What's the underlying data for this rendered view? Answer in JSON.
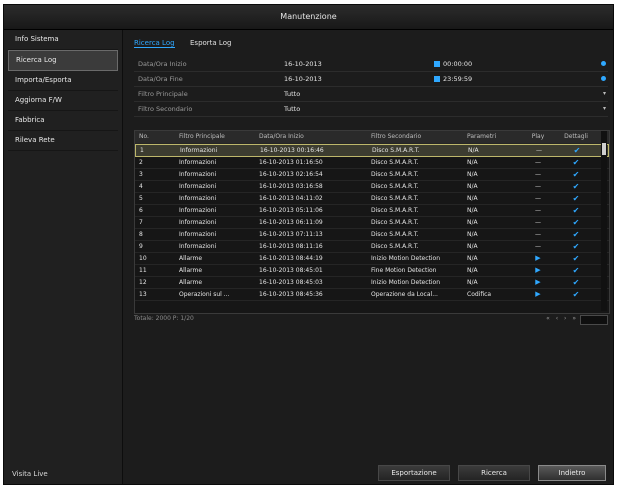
{
  "window": {
    "title": "Manutenzione"
  },
  "sidebar": {
    "items": [
      {
        "label": "Info Sistema"
      },
      {
        "label": "Ricerca Log"
      },
      {
        "label": "Importa/Esporta"
      },
      {
        "label": "Aggiorna F/W"
      },
      {
        "label": "Fabbrica"
      },
      {
        "label": "Rileva Rete"
      }
    ],
    "footer": "Visita Live"
  },
  "tabs": [
    {
      "label": "Ricerca Log"
    },
    {
      "label": "Esporta Log"
    }
  ],
  "filters": {
    "start_label": "Data/Ora Inizio",
    "start_date": "16-10-2013",
    "start_time": "00:00:00",
    "end_label": "Data/Ora Fine",
    "end_date": "16-10-2013",
    "end_time": "23:59:59",
    "primary_label": "Filtro Principale",
    "primary_value": "Tutto",
    "secondary_label": "Filtro Secondario",
    "secondary_value": "Tutto"
  },
  "table": {
    "columns": [
      "No.",
      "Filtro Principale",
      "Data/Ora Inizio",
      "Filtro Secondario",
      "Parametri",
      "Play",
      "Dettagli"
    ],
    "rows": [
      [
        "1",
        "Informazioni",
        "16-10-2013 00:16:46",
        "Disco S.M.A.R.T.",
        "N/A",
        "—",
        "✔"
      ],
      [
        "2",
        "Informazioni",
        "16-10-2013 01:16:50",
        "Disco S.M.A.R.T.",
        "N/A",
        "—",
        "✔"
      ],
      [
        "3",
        "Informazioni",
        "16-10-2013 02:16:54",
        "Disco S.M.A.R.T.",
        "N/A",
        "—",
        "✔"
      ],
      [
        "4",
        "Informazioni",
        "16-10-2013 03:16:58",
        "Disco S.M.A.R.T.",
        "N/A",
        "—",
        "✔"
      ],
      [
        "5",
        "Informazioni",
        "16-10-2013 04:11:02",
        "Disco S.M.A.R.T.",
        "N/A",
        "—",
        "✔"
      ],
      [
        "6",
        "Informazioni",
        "16-10-2013 05:11:06",
        "Disco S.M.A.R.T.",
        "N/A",
        "—",
        "✔"
      ],
      [
        "7",
        "Informazioni",
        "16-10-2013 06:11:09",
        "Disco S.M.A.R.T.",
        "N/A",
        "—",
        "✔"
      ],
      [
        "8",
        "Informazioni",
        "16-10-2013 07:11:13",
        "Disco S.M.A.R.T.",
        "N/A",
        "—",
        "✔"
      ],
      [
        "9",
        "Informazioni",
        "16-10-2013 08:11:16",
        "Disco S.M.A.R.T.",
        "N/A",
        "—",
        "✔"
      ],
      [
        "10",
        "Allarme",
        "16-10-2013 08:44:19",
        "Inizio Motion Detection",
        "N/A",
        "▶",
        "✔"
      ],
      [
        "11",
        "Allarme",
        "16-10-2013 08:45:01",
        "Fine Motion Detection",
        "N/A",
        "▶",
        "✔"
      ],
      [
        "12",
        "Allarme",
        "16-10-2013 08:45:03",
        "Inizio Motion Detection",
        "N/A",
        "▶",
        "✔"
      ],
      [
        "13",
        "Operazioni sul ...",
        "16-10-2013 08:45:36",
        "Operazione da Local...",
        "Codifica",
        "▶",
        "✔"
      ]
    ],
    "footer": "Totale: 2000  P: 1/20",
    "pager": "« ‹ › »"
  },
  "buttons": {
    "export": "Esportazione",
    "search": "Ricerca",
    "back": "Indietro"
  },
  "colors": {
    "accent": "#2fa8ff"
  }
}
